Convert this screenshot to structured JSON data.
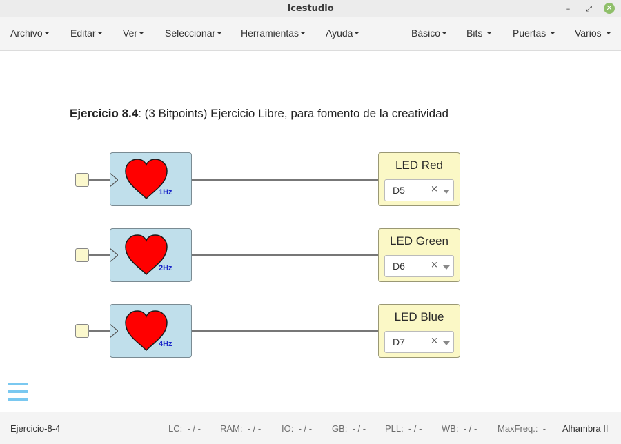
{
  "window": {
    "title": "Icestudio"
  },
  "menu": {
    "left": [
      "Archivo",
      "Editar",
      "Ver",
      "Seleccionar",
      "Herramientas",
      "Ayuda"
    ],
    "right": [
      "Básico",
      "Bits",
      "Puertas",
      "Varios"
    ]
  },
  "canvas": {
    "heading_bold": "Ejercicio 8.4",
    "heading_rest": ": (3 Bitpoints) Ejercicio Libre, para fomento de la creatividad",
    "rows": [
      {
        "freq": "1Hz",
        "led_name": "LED Red",
        "pin": "D5"
      },
      {
        "freq": "2Hz",
        "led_name": "LED Green",
        "pin": "D6"
      },
      {
        "freq": "4Hz",
        "led_name": "LED Blue",
        "pin": "D7"
      }
    ],
    "select_clear_glyph": "×"
  },
  "colors": {
    "heart": "#ff0000",
    "heart_block_bg": "#c0dfeb",
    "led_block_bg": "#fbf8c6",
    "freq_label": "#1a27c9",
    "hamburger": "#7ac8f0"
  },
  "icons": {
    "close": "close-icon",
    "minimize": "minimize-icon",
    "maximize": "maximize-icon",
    "menu": "hamburger-menu-icon",
    "heart": "heart-icon"
  },
  "status": {
    "project": "Ejercicio-8-4",
    "lc": {
      "label": "LC:",
      "value": "- / -"
    },
    "ram": {
      "label": "RAM:",
      "value": "- / -"
    },
    "io": {
      "label": "IO:",
      "value": "- / -"
    },
    "gb": {
      "label": "GB:",
      "value": "- / -"
    },
    "pll": {
      "label": "PLL:",
      "value": "- / -"
    },
    "wb": {
      "label": "WB:",
      "value": "- / -"
    },
    "maxfreq": {
      "label": "MaxFreq.:",
      "value": "-"
    },
    "board": "Alhambra II"
  }
}
